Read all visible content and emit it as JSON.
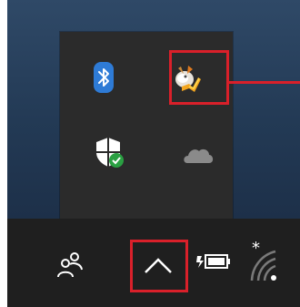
{
  "tray_overflow": {
    "icons": [
      {
        "name": "bluetooth-icon",
        "color": "#2e7bd6"
      },
      {
        "name": "app-flame-icon",
        "highlighted": true,
        "highlight_color": "#d9202a"
      },
      {
        "name": "windows-security-icon",
        "badge_color": "#2aa042"
      },
      {
        "name": "onedrive-cloud-icon",
        "color": "#8a8a8a"
      }
    ]
  },
  "taskbar": {
    "items": [
      {
        "name": "people-icon"
      },
      {
        "name": "show-hidden-icons-chevron-icon",
        "highlighted": true
      },
      {
        "name": "battery-charging-icon"
      },
      {
        "name": "wifi-no-internet-icon"
      }
    ]
  },
  "colors": {
    "desktop": "#233a55",
    "popup_bg": "#2b2b2b",
    "taskbar_bg": "#1f1f1f",
    "highlight": "#d9202a"
  }
}
